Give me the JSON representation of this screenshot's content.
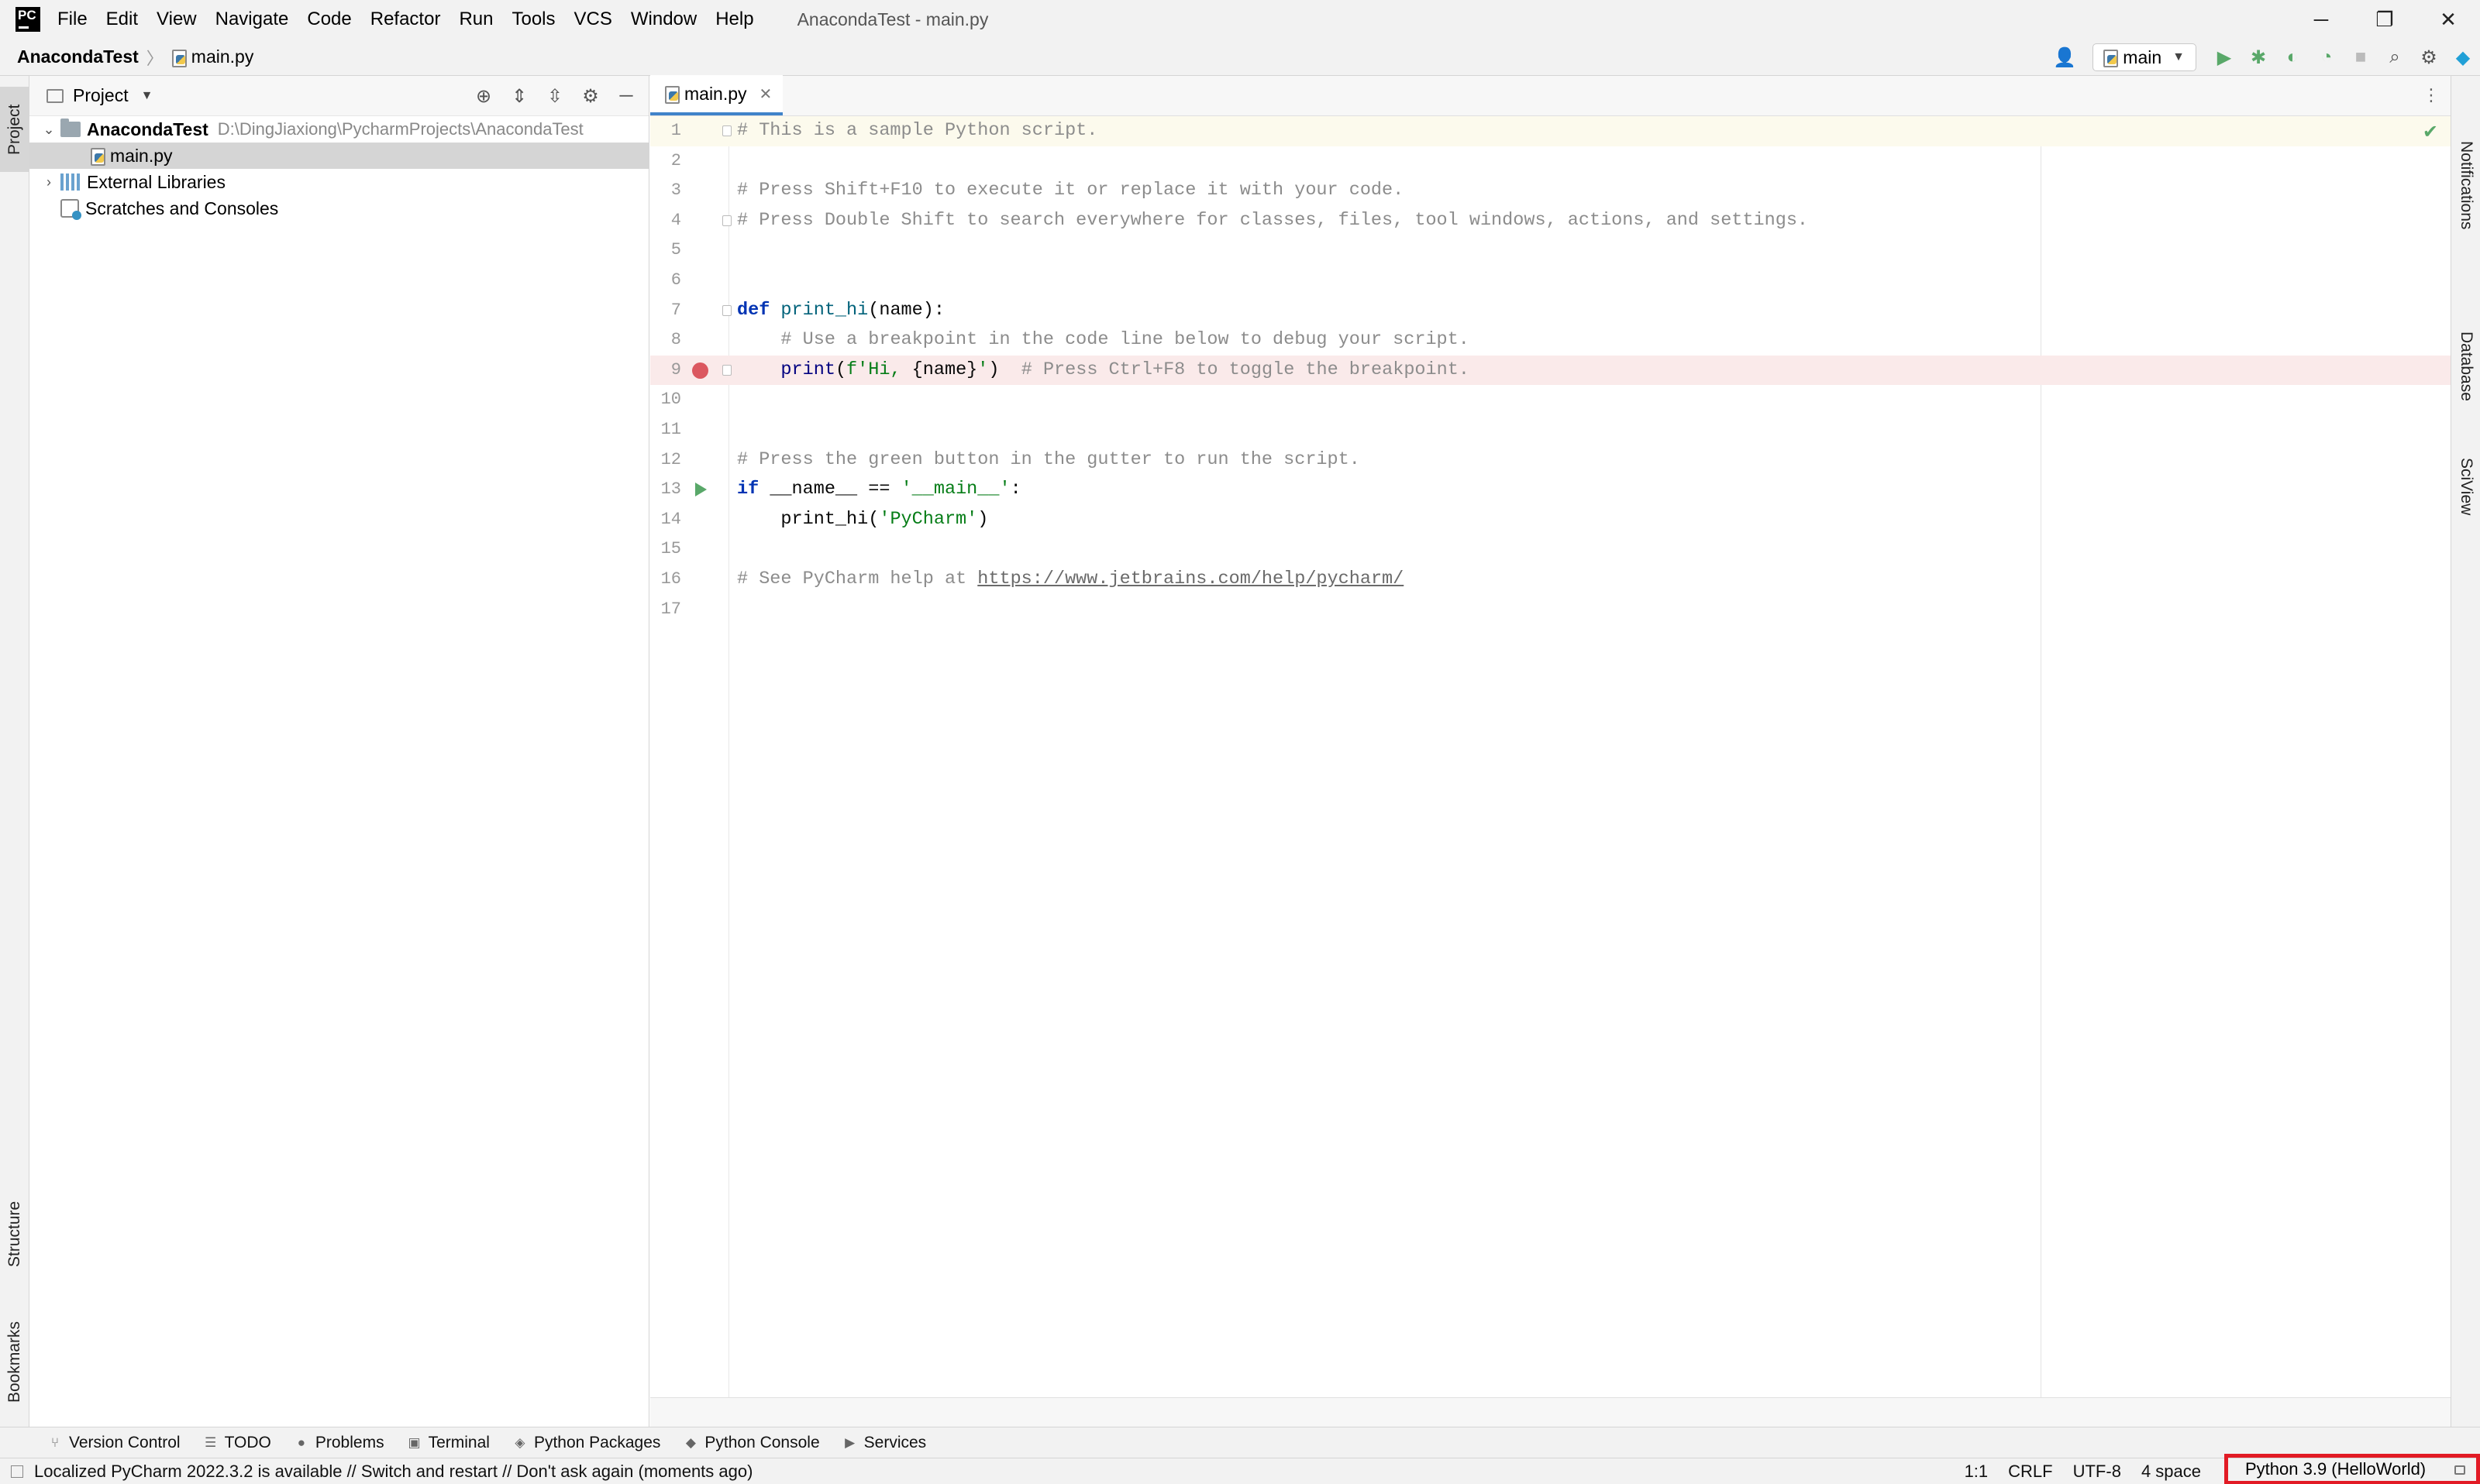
{
  "window": {
    "title": "AnacondaTest - main.py",
    "menu": [
      "File",
      "Edit",
      "View",
      "Navigate",
      "Code",
      "Refactor",
      "Run",
      "Tools",
      "VCS",
      "Window",
      "Help"
    ],
    "controls": {
      "minimize": "─",
      "restore": "❐",
      "close": "✕"
    }
  },
  "navbar": {
    "project": "AnacondaTest",
    "separator": "〉",
    "file": "main.py",
    "run_config": "main"
  },
  "left_stripe": {
    "project": "Project",
    "structure": "Structure",
    "bookmarks": "Bookmarks"
  },
  "right_stripe": {
    "notifications": "Notifications",
    "database": "Database",
    "sciview": "SciView"
  },
  "project_panel": {
    "title": "Project",
    "tree": {
      "root_name": "AnacondaTest",
      "root_path": "D:\\DingJiaxiong\\PycharmProjects\\AnacondaTest",
      "file": "main.py",
      "external": "External Libraries",
      "scratches": "Scratches and Consoles"
    }
  },
  "editor": {
    "tab": "main.py",
    "current_line": 1,
    "breakpoint_line": 9,
    "run_marker_line": 13,
    "lines": [
      {
        "n": "1"
      },
      {
        "n": "2"
      },
      {
        "n": "3"
      },
      {
        "n": "4"
      },
      {
        "n": "5"
      },
      {
        "n": "6"
      },
      {
        "n": "7"
      },
      {
        "n": "8"
      },
      {
        "n": "9"
      },
      {
        "n": "10"
      },
      {
        "n": "11"
      },
      {
        "n": "12"
      },
      {
        "n": "13"
      },
      {
        "n": "14"
      },
      {
        "n": "15"
      },
      {
        "n": "16"
      },
      {
        "n": "17"
      }
    ],
    "code": {
      "l1": "# This is a sample Python script.",
      "l3": "# Press Shift+F10 to execute it or replace it with your code.",
      "l4": "# Press Double Shift to search everywhere for classes, files, tool windows, actions, and settings.",
      "l7_kw": "def",
      "l7_fn": "print_hi",
      "l7_rest": "(name):",
      "l8": "# Use a breakpoint in the code line below to debug your script.",
      "l9_fn": "print",
      "l9_open": "(",
      "l9_str1": "f'Hi, ",
      "l9_var": "{name}",
      "l9_str2": "'",
      "l9_close": ")",
      "l9_comment": "# Press Ctrl+F8 to toggle the breakpoint.",
      "l12": "# Press the green button in the gutter to run the script.",
      "l13_kw": "if",
      "l13_mid": " __name__ == ",
      "l13_str": "'__main__'",
      "l13_end": ":",
      "l14_call": "print_hi(",
      "l14_str": "'PyCharm'",
      "l14_end": ")",
      "l16_pre": "# See PyCharm help at ",
      "l16_link": "https://www.jetbrains.com/help/pycharm/"
    }
  },
  "tool_windows": [
    {
      "label": "Version Control",
      "icon": "branch-icon",
      "glyph": "⑂"
    },
    {
      "label": "TODO",
      "icon": "list-icon",
      "glyph": "☰"
    },
    {
      "label": "Problems",
      "icon": "problems-icon",
      "glyph": "●"
    },
    {
      "label": "Terminal",
      "icon": "terminal-icon",
      "glyph": "▣"
    },
    {
      "label": "Python Packages",
      "icon": "packages-icon",
      "glyph": "◈"
    },
    {
      "label": "Python Console",
      "icon": "console-icon",
      "glyph": "◆"
    },
    {
      "label": "Services",
      "icon": "services-icon",
      "glyph": "▶"
    }
  ],
  "status": {
    "message": "Localized PyCharm 2022.3.2 is available // Switch and restart // Don't ask again (moments ago)",
    "position": "1:1",
    "line_sep": "CRLF",
    "encoding": "UTF-8",
    "indent": "4 space",
    "interpreter": "Python 3.9 (HelloWorld)"
  },
  "colors": {
    "highlight_box": "#e21b25",
    "breakpoint": "#db5860",
    "run_marker": "#59a869",
    "tab_underline": "#4083c9"
  }
}
